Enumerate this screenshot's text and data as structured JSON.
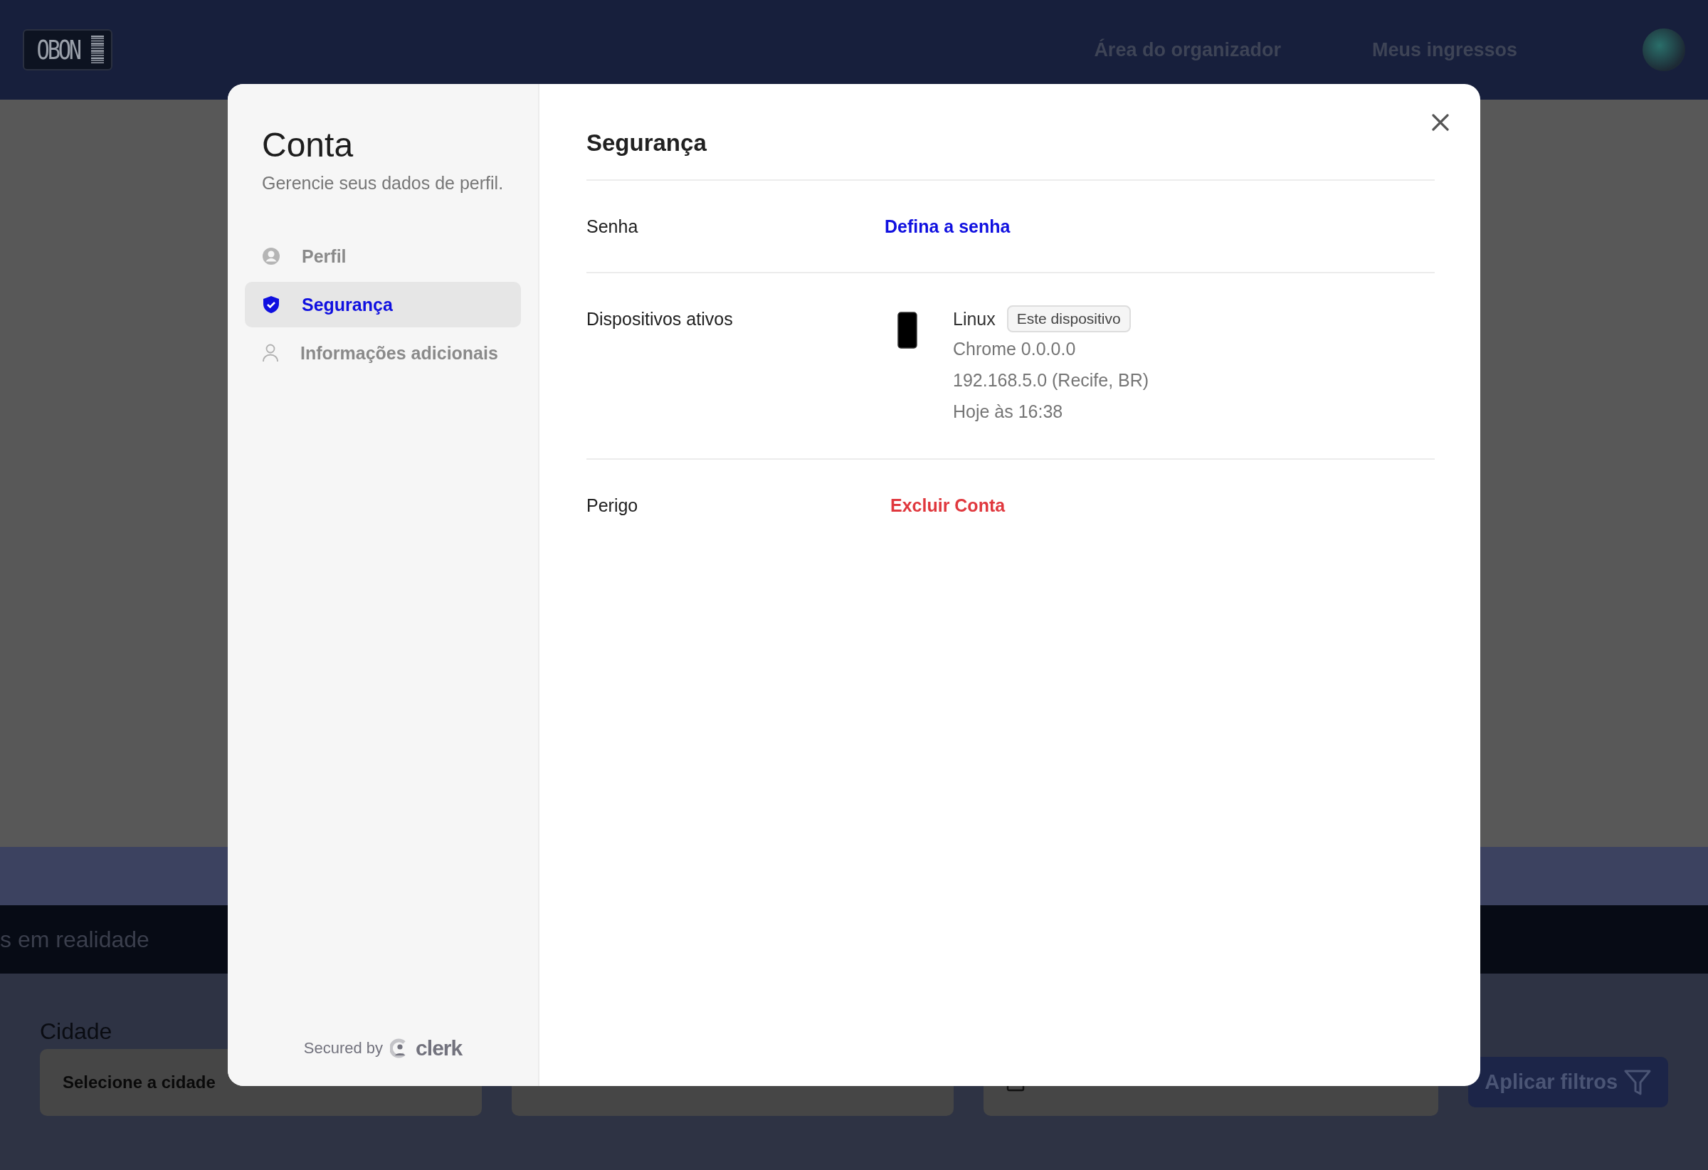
{
  "header": {
    "logo": "OBON",
    "nav": [
      {
        "label": "Área do organizador"
      },
      {
        "label": "Meus ingressos"
      }
    ]
  },
  "banner": {
    "text": "s em realidade"
  },
  "filters": {
    "fields": [
      {
        "label": "Cidade",
        "text": "Selecione a cidade",
        "kind": "select"
      },
      {
        "kind": "select"
      },
      {
        "kind": "date"
      }
    ],
    "button": "Aplicar filtros"
  },
  "modal": {
    "title": "Conta",
    "subtitle": "Gerencie seus dados de perfil.",
    "nav": [
      {
        "label": "Perfil",
        "selected": false
      },
      {
        "label": "Segurança",
        "selected": true
      },
      {
        "label": "Informações adicionais",
        "selected": false
      }
    ],
    "footer": {
      "text": "Secured by",
      "brand": "clerk"
    },
    "section_title": "Segurança",
    "rows": [
      {
        "label": "Senha",
        "kind": "link",
        "value": "Defina a senha"
      },
      {
        "label": "Dispositivos ativos",
        "kind": "device",
        "os": "Linux",
        "badge": "Este dispositivo",
        "details": [
          "Chrome 0.0.0.0",
          "192.168.5.0 (Recife, BR)",
          "Hoje às 16:38"
        ]
      },
      {
        "label": "Perigo",
        "kind": "danger",
        "value": "Excluir Conta"
      }
    ]
  }
}
